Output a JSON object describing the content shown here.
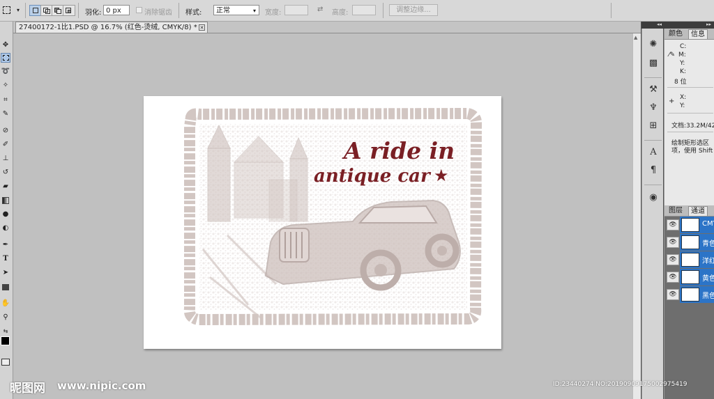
{
  "options_bar": {
    "feather_label": "羽化:",
    "feather_value": "0 px",
    "antialias_label": "消除锯齿",
    "style_label": "样式:",
    "style_value": "正常",
    "width_label": "宽度:",
    "height_label": "高度:",
    "refine_edge_label": "调整边缘..."
  },
  "document": {
    "tab_title": "27400172-1比1.PSD @ 16.7% (红色-烫绒, CMYK/8) *",
    "artwork_line1": "A ride in",
    "artwork_line2": "antique car",
    "artwork_star": "★"
  },
  "info_panel": {
    "tabs": [
      "颜色",
      "信息"
    ],
    "active_tab": "信息",
    "c_label": "C:",
    "m_label": "M:",
    "y_label": "Y:",
    "k_label": "K:",
    "bit_depth": "8 位",
    "x_label": "X:",
    "y2_label": "Y:",
    "doc_size": "文档:33.2M/42",
    "hint_line1": "绘制矩形选区",
    "hint_line2": "项，使用 Shift"
  },
  "layers_panel": {
    "tabs": [
      "图层",
      "通道"
    ],
    "active_tab": "通道",
    "channels": [
      {
        "name": "CMYK"
      },
      {
        "name": "青色"
      },
      {
        "name": "洋红"
      },
      {
        "name": "黄色"
      },
      {
        "name": "黑色"
      }
    ]
  },
  "watermark": {
    "logo_text": "昵图网",
    "site": "www.nipic.com",
    "id_text": "ID:23440274 NO:20190909175002975419"
  },
  "colors": {
    "artwork_red": "#7a1f24",
    "artwork_gray": "#d2c6c2",
    "selection_blue": "#2c74c7",
    "canvas_bg": "#c0c0c0"
  }
}
